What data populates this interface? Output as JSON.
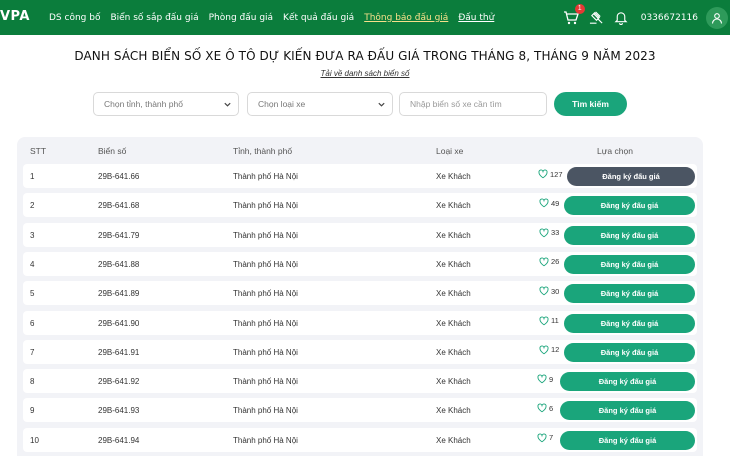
{
  "header": {
    "logo": "VPA",
    "nav": [
      {
        "label": "DS công bố",
        "style": "normal"
      },
      {
        "label": "Biển số sắp đấu giá",
        "style": "normal"
      },
      {
        "label": "Phòng đấu giá",
        "style": "normal"
      },
      {
        "label": "Kết quả đấu giá",
        "style": "normal"
      },
      {
        "label": "Thông báo đấu giá",
        "style": "active"
      },
      {
        "label": "Đấu thử",
        "style": "underline"
      }
    ],
    "cart_count": "1",
    "phone": "0336672116",
    "icons": [
      "cart-icon",
      "gavel-icon",
      "bell-icon",
      "user-icon"
    ]
  },
  "title": "DANH SÁCH BIỂN SỐ XE Ô TÔ DỰ KIẾN ĐƯA RA ĐẤU GIÁ TRONG THÁNG 8, THÁNG 9 NĂM 2023",
  "download_link": "Tải về danh sách biển số",
  "filters": {
    "province_placeholder": "Chọn tỉnh, thành phố",
    "vehicle_type_placeholder": "Chọn loại xe",
    "plate_placeholder": "Nhập biển số xe cần tìm",
    "search_label": "Tìm kiếm"
  },
  "table": {
    "columns": [
      "STT",
      "Biển số",
      "Tỉnh, thành phố",
      "Loại xe",
      "Lựa chọn"
    ],
    "button_label": "Đăng ký đấu giá",
    "rows": [
      {
        "stt": "1",
        "plate": "29B-641.66",
        "province": "Thành phố Hà Nội",
        "type": "Xe Khách",
        "likes": "127",
        "highlighted": true
      },
      {
        "stt": "2",
        "plate": "29B-641.68",
        "province": "Thành phố Hà Nội",
        "type": "Xe Khách",
        "likes": "49",
        "highlighted": false
      },
      {
        "stt": "3",
        "plate": "29B-641.79",
        "province": "Thành phố Hà Nội",
        "type": "Xe Khách",
        "likes": "33",
        "highlighted": false
      },
      {
        "stt": "4",
        "plate": "29B-641.88",
        "province": "Thành phố Hà Nội",
        "type": "Xe Khách",
        "likes": "26",
        "highlighted": false
      },
      {
        "stt": "5",
        "plate": "29B-641.89",
        "province": "Thành phố Hà Nội",
        "type": "Xe Khách",
        "likes": "30",
        "highlighted": false
      },
      {
        "stt": "6",
        "plate": "29B-641.90",
        "province": "Thành phố Hà Nội",
        "type": "Xe Khách",
        "likes": "11",
        "highlighted": false
      },
      {
        "stt": "7",
        "plate": "29B-641.91",
        "province": "Thành phố Hà Nội",
        "type": "Xe Khách",
        "likes": "12",
        "highlighted": false
      },
      {
        "stt": "8",
        "plate": "29B-641.92",
        "province": "Thành phố Hà Nội",
        "type": "Xe Khách",
        "likes": "9",
        "highlighted": false
      },
      {
        "stt": "9",
        "plate": "29B-641.93",
        "province": "Thành phố Hà Nội",
        "type": "Xe Khách",
        "likes": "6",
        "highlighted": false
      },
      {
        "stt": "10",
        "plate": "29B-641.94",
        "province": "Thành phố Hà Nội",
        "type": "Xe Khách",
        "likes": "7",
        "highlighted": false
      }
    ]
  },
  "colors": {
    "header_bg": "#0b7d3c",
    "accent": "#1aa57b",
    "active_nav": "#f6e08a",
    "highlight_button": "#4b5563"
  }
}
